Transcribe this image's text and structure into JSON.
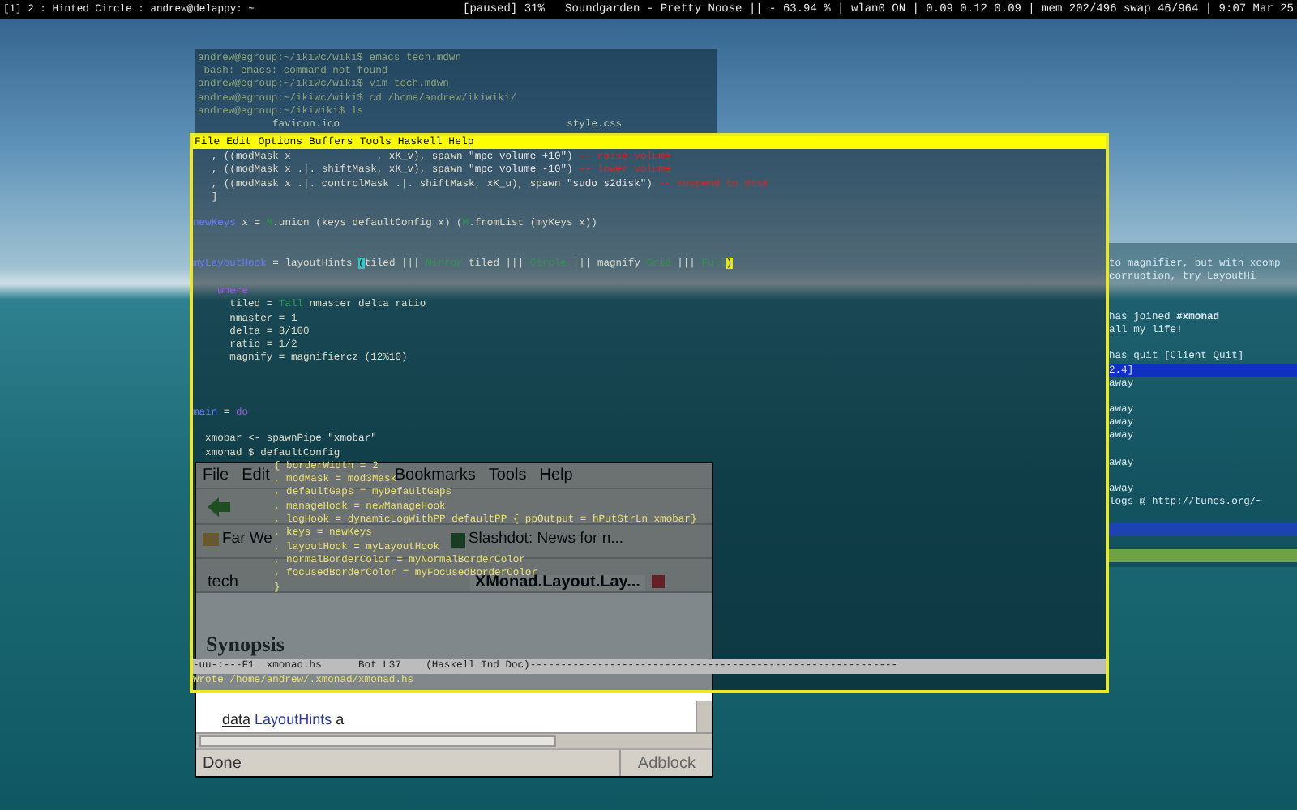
{
  "status_bar": {
    "left": "[1] 2 : Hinted Circle : andrew@delappy: ~",
    "right": "[paused] 31%   Soundgarden - Pretty Noose || - 63.94 % | wlan0 ON | 0.09 0.12 0.09 | mem 202/496 swap 46/964 | 9:07 Mar 25"
  },
  "terminal": {
    "lines": [
      "andrew@egroup:~/ikiwc/wiki$ emacs tech.mdwn",
      "-bash: emacs: command not found",
      "andrew@egroup:~/ikiwc/wiki$ vim tech.mdwn",
      "andrew@egroup:~/ikiwc/wiki$ cd /home/andrew/ikiwiki/",
      "andrew@egroup:~/ikiwiki$ ls"
    ],
    "files": [
      "favicon.ico",
      "style.css"
    ]
  },
  "browser": {
    "menu": [
      "File",
      "Edit",
      "Bookmarks",
      "Tools",
      "Help"
    ],
    "bookmarks": [
      "Far We",
      "Slashdot: News for n..."
    ],
    "tabs": [
      {
        "label": "tech",
        "selected": false
      },
      {
        "label": "XMonad.Layout.Lay...",
        "selected": true
      }
    ],
    "heading": "Synopsis",
    "code_keyword": "data",
    "code_type": "LayoutHints",
    "code_arg": "a",
    "status": "Done",
    "addon": "Adblock"
  },
  "irc": {
    "lines": [
      {
        "kind": "text",
        "text": "to magnifier, but with xcomp"
      },
      {
        "kind": "text",
        "text": "corruption, try LayoutHi"
      },
      {
        "kind": "blank"
      },
      {
        "kind": "blank"
      },
      {
        "kind": "text",
        "text": "has joined **#xmonad**"
      },
      {
        "kind": "text",
        "text": "all my life!"
      },
      {
        "kind": "blank"
      },
      {
        "kind": "text",
        "text": "has quit [Client Quit]"
      },
      {
        "kind": "highlight",
        "text": "2.4]"
      },
      {
        "kind": "text",
        "text": "away"
      },
      {
        "kind": "blank"
      },
      {
        "kind": "text",
        "text": "away"
      },
      {
        "kind": "text",
        "text": "away"
      },
      {
        "kind": "text",
        "text": "away"
      },
      {
        "kind": "blank"
      },
      {
        "kind": "text",
        "text": "away"
      },
      {
        "kind": "blank"
      },
      {
        "kind": "text",
        "text": "away"
      },
      {
        "kind": "text",
        "text": "logs @ http://tunes.org/~"
      },
      {
        "kind": "blank"
      },
      {
        "kind": "input"
      },
      {
        "kind": "blank"
      },
      {
        "kind": "statusbar"
      }
    ]
  },
  "emacs": {
    "menu": [
      "File",
      "Edit",
      "Options",
      "Buffers",
      "Tools",
      "Haskell",
      "Help"
    ],
    "lines": [
      {
        "kind": "code",
        "segments": [
          {
            "t": "   , ((modMask x              , xK_v), spawn ",
            "kind": "plain"
          },
          {
            "t": "\"mpc volume +10\"",
            "kind": "string"
          },
          {
            "t": ") ",
            "kind": "plain"
          },
          {
            "t": "-- raise volume",
            "kind": "comment"
          }
        ]
      },
      {
        "kind": "code",
        "segments": [
          {
            "t": "   , ((modMask x .|. shiftMask, xK_v), spawn ",
            "kind": "plain"
          },
          {
            "t": "\"mpc volume -10\"",
            "kind": "string"
          },
          {
            "t": ") ",
            "kind": "plain"
          },
          {
            "t": "-- lower volume",
            "kind": "comment"
          }
        ]
      },
      {
        "kind": "code",
        "segments": [
          {
            "t": "   , ((modMask x .|. controlMask .|. shiftMask, xK_u), spawn ",
            "kind": "plain"
          },
          {
            "t": "\"sudo s2disk\"",
            "kind": "string"
          },
          {
            "t": ") ",
            "kind": "plain"
          },
          {
            "t": "-- suspend to disk",
            "kind": "comment"
          }
        ]
      },
      {
        "kind": "code",
        "segments": [
          {
            "t": "   ]",
            "kind": "plain"
          }
        ]
      },
      {
        "kind": "blank"
      },
      {
        "kind": "code",
        "segments": [
          {
            "t": "newKeys",
            "kind": "def"
          },
          {
            "t": " x = ",
            "kind": "plain"
          },
          {
            "t": "M",
            "kind": "type"
          },
          {
            "t": ".union (keys defaultConfig x) (",
            "kind": "plain"
          },
          {
            "t": "M",
            "kind": "type"
          },
          {
            "t": ".fromList (myKeys x))",
            "kind": "plain"
          }
        ]
      },
      {
        "kind": "blank"
      },
      {
        "kind": "blank"
      },
      {
        "kind": "code",
        "segments": [
          {
            "t": "myLayoutHook",
            "kind": "def"
          },
          {
            "t": " = layoutHints ",
            "kind": "plain"
          },
          {
            "t": "(",
            "kind": "cursor"
          },
          {
            "t": "tiled ||| ",
            "kind": "plain"
          },
          {
            "t": "Mirror",
            "kind": "type"
          },
          {
            "t": " tiled ||| ",
            "kind": "plain"
          },
          {
            "t": "Circle",
            "kind": "type"
          },
          {
            "t": " ||| magnify ",
            "kind": "plain"
          },
          {
            "t": "Grid",
            "kind": "type"
          },
          {
            "t": " ||| ",
            "kind": "plain"
          },
          {
            "t": "Full",
            "kind": "type"
          },
          {
            "t": ")",
            "kind": "paren"
          }
        ]
      },
      {
        "kind": "blank"
      },
      {
        "kind": "code",
        "segments": [
          {
            "t": "    where",
            "kind": "keyword"
          }
        ]
      },
      {
        "kind": "code",
        "segments": [
          {
            "t": "      tiled = ",
            "kind": "plain"
          },
          {
            "t": "Tall",
            "kind": "type"
          },
          {
            "t": " nmaster delta ratio",
            "kind": "plain"
          }
        ]
      },
      {
        "kind": "code",
        "segments": [
          {
            "t": "      nmaster = 1",
            "kind": "plain"
          }
        ]
      },
      {
        "kind": "code",
        "segments": [
          {
            "t": "      delta = 3/100",
            "kind": "plain"
          }
        ]
      },
      {
        "kind": "code",
        "segments": [
          {
            "t": "      ratio = 1/2",
            "kind": "plain"
          }
        ]
      },
      {
        "kind": "code",
        "segments": [
          {
            "t": "      magnify = magnifiercz (12%10)",
            "kind": "plain"
          }
        ]
      },
      {
        "kind": "blank"
      },
      {
        "kind": "blank"
      },
      {
        "kind": "blank"
      },
      {
        "kind": "code",
        "segments": [
          {
            "t": "main",
            "kind": "def"
          },
          {
            "t": " = ",
            "kind": "plain"
          },
          {
            "t": "do",
            "kind": "keyword"
          }
        ]
      },
      {
        "kind": "blank"
      },
      {
        "kind": "code",
        "segments": [
          {
            "t": "  xmobar <- spawnPipe ",
            "kind": "plain"
          },
          {
            "t": "\"xmobar\"",
            "kind": "string"
          }
        ]
      },
      {
        "kind": "code",
        "segments": [
          {
            "t": "  xmonad $ defaultConfig",
            "kind": "plain"
          }
        ]
      },
      {
        "kind": "record",
        "text": "{ borderWidth = 2"
      },
      {
        "kind": "record",
        "text": ", modMask = mod3Mask"
      },
      {
        "kind": "record",
        "text": ", defaultGaps = myDefaultGaps"
      },
      {
        "kind": "record",
        "text": ", manageHook = newManageHook"
      },
      {
        "kind": "record",
        "text": ", logHook = dynamicLogWithPP defaultPP { ppOutput = hPutStrLn xmobar}"
      },
      {
        "kind": "record",
        "text": ", keys = newKeys"
      },
      {
        "kind": "record",
        "text": ", layoutHook = myLayoutHook"
      },
      {
        "kind": "record",
        "text": ", normalBorderColor = myNormalBorderColor"
      },
      {
        "kind": "record",
        "text": ", focusedBorderColor = myFocusedBorderColor"
      },
      {
        "kind": "record",
        "text": "}"
      }
    ],
    "mode_line": "-uu-:---F1  xmonad.hs      Bot L37    (Haskell Ind Doc)------------------------------------------------------------",
    "minibuffer": "Wrote /home/andrew/.xmonad/xmonad.hs"
  }
}
